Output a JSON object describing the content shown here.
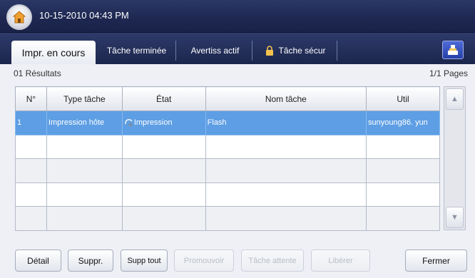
{
  "header": {
    "datetime": "10-15-2010 04:43 PM",
    "home_icon": "home-icon"
  },
  "tabs": [
    {
      "label": "Impr. en cours",
      "active": true
    },
    {
      "label": "Tâche terminée",
      "active": false
    },
    {
      "label": "Avertiss actif",
      "active": false
    },
    {
      "label": "Tâche sécur",
      "active": false,
      "icon": "lock-icon"
    }
  ],
  "toolbar": {
    "right_icon": "job-queue-icon"
  },
  "results": {
    "count_label": "01 Résultats",
    "pages_label": "1/1 Pages"
  },
  "table": {
    "columns": [
      "N°",
      "Type tâche",
      "État",
      "Nom tâche",
      "Util"
    ],
    "rows": [
      {
        "no": "1",
        "type": "Impression hôte",
        "state": "Impression",
        "name": "Flash",
        "user": "sunyoung86. yun"
      }
    ]
  },
  "buttons": {
    "detail": "Détail",
    "delete": "Suppr.",
    "delete_all": "Supp tout",
    "promote": "Promouvoir",
    "hold": "Tâche attente",
    "release": "Libérer",
    "close": "Fermer"
  },
  "colors": {
    "selected_row": "#5d9ee4",
    "header_bar": "#1d2750"
  }
}
